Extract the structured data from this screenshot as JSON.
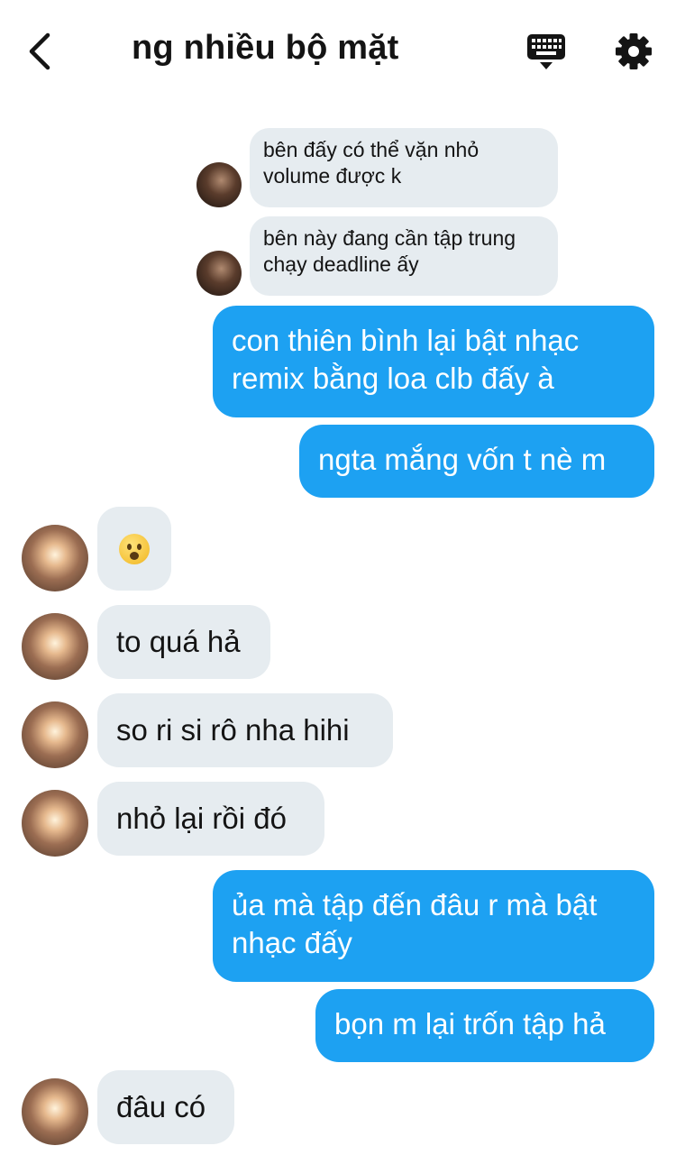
{
  "header": {
    "title": "ng nhiều bộ mặt",
    "back_icon": "chevron-left-icon",
    "keyboard_icon": "keyboard-icon",
    "settings_icon": "gear-icon"
  },
  "colors": {
    "outgoing_bubble": "#1da1f2",
    "incoming_bubble": "#e6ecf0",
    "outgoing_text": "#ffffff",
    "incoming_text": "#141414"
  },
  "messages": [
    {
      "direction": "in",
      "text": "bên đấy có thể vặn nhỏ volume được k"
    },
    {
      "direction": "in",
      "text": "bên này đang cần tập trung chạy deadline ấy"
    },
    {
      "direction": "out",
      "text": "con thiên bình lại bật nhạc remix bằng loa clb đấy à"
    },
    {
      "direction": "out",
      "text": "ngta mắng vốn t nè m"
    },
    {
      "direction": "in",
      "text": "",
      "emoji": "frowning-face-open-mouth"
    },
    {
      "direction": "in",
      "text": "to quá hả"
    },
    {
      "direction": "in",
      "text": "so ri si rô nha hihi"
    },
    {
      "direction": "in",
      "text": "nhỏ lại rồi đó"
    },
    {
      "direction": "out",
      "text": "ủa mà tập đến đâu r mà bật nhạc đấy"
    },
    {
      "direction": "out",
      "text": "bọn m lại trốn tập hả"
    },
    {
      "direction": "in",
      "text": "đâu có"
    }
  ]
}
